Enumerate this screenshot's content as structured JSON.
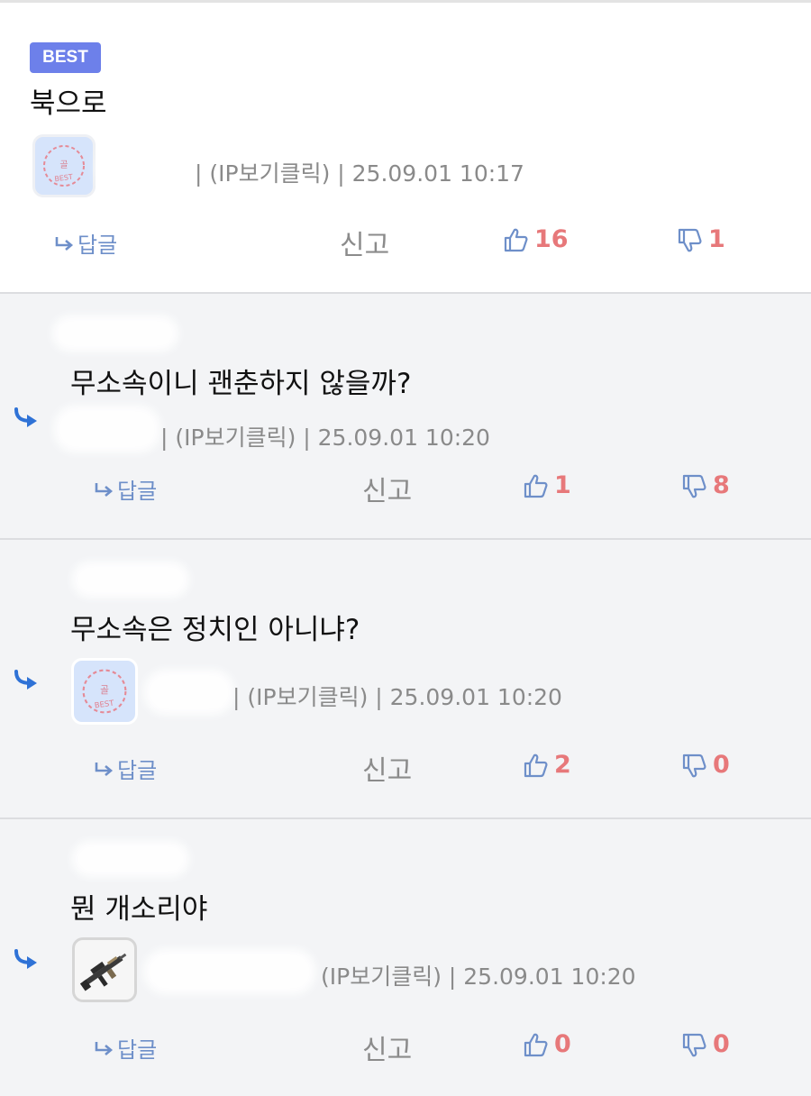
{
  "comments": [
    {
      "badge": "BEST",
      "text": "북으로",
      "meta_ip": "| (IP보기클릭) | 25.09.01 10:17",
      "reply_label": "답글",
      "report_label": "신고",
      "likes": "16",
      "dislikes": "1"
    },
    {
      "text": "무소속이니 괜춘하지 않을까?",
      "meta_ip": "| (IP보기클릭) | 25.09.01 10:20",
      "reply_label": "답글",
      "report_label": "신고",
      "likes": "1",
      "dislikes": "8"
    },
    {
      "text": "무소속은 정치인 아니냐?",
      "meta_ip": "| (IP보기클릭) | 25.09.01 10:20",
      "reply_label": "답글",
      "report_label": "신고",
      "likes": "2",
      "dislikes": "0"
    },
    {
      "text": "뭔 개소리야",
      "meta_ip": "(IP보기클릭) | 25.09.01 10:20",
      "reply_label": "답글",
      "report_label": "신고",
      "likes": "0",
      "dislikes": "0"
    }
  ],
  "avatar_stamp": {
    "top": "골",
    "bottom": "BEST"
  },
  "icons": {
    "reply": "reply-arrow-icon",
    "thread": "thread-reply-arrow-icon",
    "like": "thumbs-up-icon",
    "dislike": "thumbs-down-icon"
  },
  "colors": {
    "badge_bg": "#6d80ea",
    "vote_count": "#e7787a",
    "icon_blue": "#6e8fc9",
    "thread_arrow": "#2f72d6"
  }
}
